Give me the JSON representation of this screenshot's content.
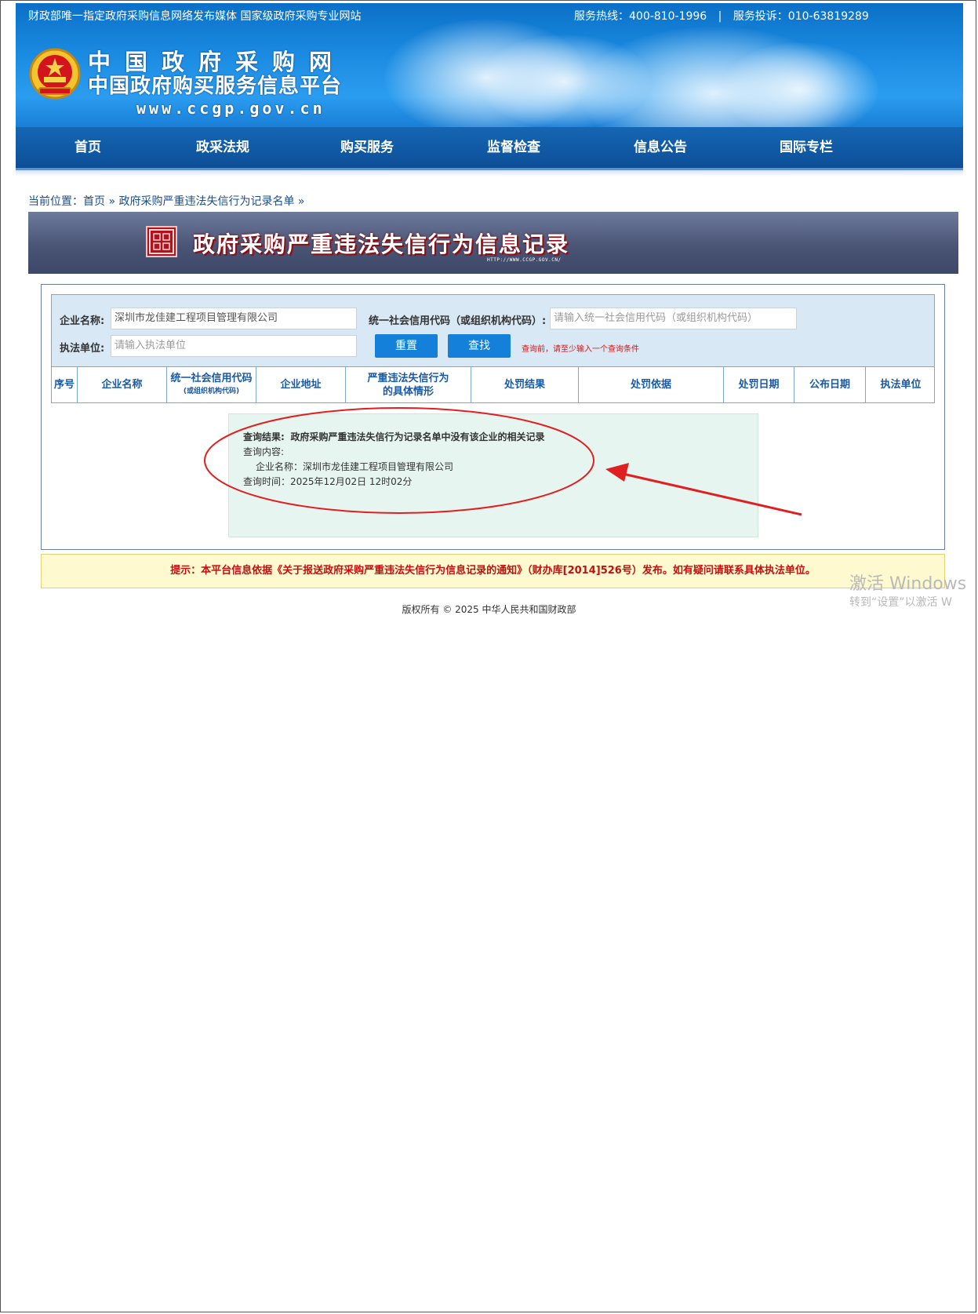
{
  "topbar": {
    "left_text": "财政部唯一指定政府采购信息网络发布媒体 国家级政府采购专业网站",
    "hotline": "服务热线：400-810-1996",
    "separator": "|",
    "complaint": "服务投诉：010-63819289"
  },
  "logo": {
    "line1": "中国政府采购网",
    "line2": "中国政府购买服务信息平台",
    "line3": "www.ccgp.gov.cn"
  },
  "nav": {
    "items": [
      "首页",
      "政采法规",
      "购买服务",
      "监督检查",
      "信息公告",
      "国际专栏"
    ]
  },
  "breadcrumb": "当前位置：首页 » 政府采购严重违法失信行为记录名单 »",
  "banner": {
    "title": "政府采购严重违法失信行为信息记录",
    "url": "HTTP://WWW.CCGP.GOV.CN/"
  },
  "search": {
    "company_label": "企业名称:",
    "company_value": "深圳市龙佳建工程项目管理有限公司",
    "credit_label": "统一社会信用代码（或组织机构代码）:",
    "credit_placeholder": "请输入统一社会信用代码（或组织机构代码）",
    "unit_label": "执法单位:",
    "unit_placeholder": "请输入执法单位",
    "reset_button": "重置",
    "search_button": "查找",
    "hint": "查询前，请至少输入一个查询条件"
  },
  "table": {
    "headers": [
      {
        "main": "序号",
        "sub": ""
      },
      {
        "main": "企业名称",
        "sub": ""
      },
      {
        "main": "统一社会信用代码",
        "sub": "(或组织机构代码)"
      },
      {
        "main": "企业地址",
        "sub": ""
      },
      {
        "main": "严重违法失信行为",
        "sub": "的具体情形"
      },
      {
        "main": "处罚结果",
        "sub": ""
      },
      {
        "main": "处罚依据",
        "sub": ""
      },
      {
        "main": "处罚日期",
        "sub": ""
      },
      {
        "main": "公布日期",
        "sub": ""
      },
      {
        "main": "执法单位",
        "sub": ""
      }
    ]
  },
  "result": {
    "result_label": "查询结果:",
    "result_text": "政府采购严重违法失信行为记录名单中没有该企业的相关记录",
    "content_label": "查询内容:",
    "company_line": "企业名称：深圳市龙佳建工程项目管理有限公司",
    "time_line": "查询时间：2025年12月02日 12时02分"
  },
  "notice": "提示：本平台信息依据《关于报送政府采购严重违法失信行为信息记录的通知》（财办库[2014]526号）发布。如有疑问请联系具体执法单位。",
  "footer": "版权所有 © 2025 中华人民共和国财政部",
  "watermark": {
    "line1": "激活 Windows",
    "line2": "转到“设置”以激活 W"
  },
  "colors": {
    "header_blue": "#1a8ae0",
    "nav_blue": "#0d4f97",
    "button_blue": "#1580d9",
    "annotation_red": "#e02020",
    "notice_red": "#c01010"
  }
}
